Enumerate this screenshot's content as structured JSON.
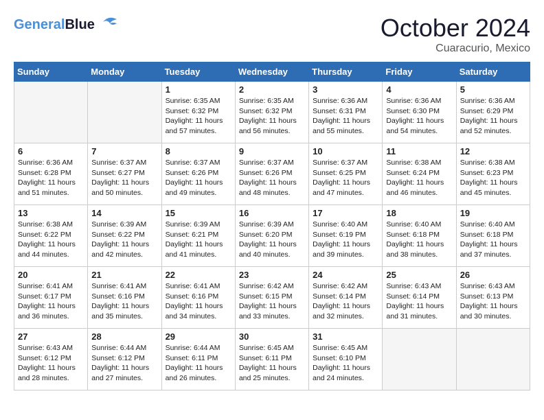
{
  "header": {
    "logo_line1": "General",
    "logo_line2": "Blue",
    "month": "October 2024",
    "location": "Cuaracurio, Mexico"
  },
  "days_of_week": [
    "Sunday",
    "Monday",
    "Tuesday",
    "Wednesday",
    "Thursday",
    "Friday",
    "Saturday"
  ],
  "weeks": [
    [
      {
        "day": "",
        "empty": true
      },
      {
        "day": "",
        "empty": true
      },
      {
        "day": "1",
        "lines": [
          "Sunrise: 6:35 AM",
          "Sunset: 6:32 PM",
          "Daylight: 11 hours",
          "and 57 minutes."
        ]
      },
      {
        "day": "2",
        "lines": [
          "Sunrise: 6:35 AM",
          "Sunset: 6:32 PM",
          "Daylight: 11 hours",
          "and 56 minutes."
        ]
      },
      {
        "day": "3",
        "lines": [
          "Sunrise: 6:36 AM",
          "Sunset: 6:31 PM",
          "Daylight: 11 hours",
          "and 55 minutes."
        ]
      },
      {
        "day": "4",
        "lines": [
          "Sunrise: 6:36 AM",
          "Sunset: 6:30 PM",
          "Daylight: 11 hours",
          "and 54 minutes."
        ]
      },
      {
        "day": "5",
        "lines": [
          "Sunrise: 6:36 AM",
          "Sunset: 6:29 PM",
          "Daylight: 11 hours",
          "and 52 minutes."
        ]
      }
    ],
    [
      {
        "day": "6",
        "lines": [
          "Sunrise: 6:36 AM",
          "Sunset: 6:28 PM",
          "Daylight: 11 hours",
          "and 51 minutes."
        ]
      },
      {
        "day": "7",
        "lines": [
          "Sunrise: 6:37 AM",
          "Sunset: 6:27 PM",
          "Daylight: 11 hours",
          "and 50 minutes."
        ]
      },
      {
        "day": "8",
        "lines": [
          "Sunrise: 6:37 AM",
          "Sunset: 6:26 PM",
          "Daylight: 11 hours",
          "and 49 minutes."
        ]
      },
      {
        "day": "9",
        "lines": [
          "Sunrise: 6:37 AM",
          "Sunset: 6:26 PM",
          "Daylight: 11 hours",
          "and 48 minutes."
        ]
      },
      {
        "day": "10",
        "lines": [
          "Sunrise: 6:37 AM",
          "Sunset: 6:25 PM",
          "Daylight: 11 hours",
          "and 47 minutes."
        ]
      },
      {
        "day": "11",
        "lines": [
          "Sunrise: 6:38 AM",
          "Sunset: 6:24 PM",
          "Daylight: 11 hours",
          "and 46 minutes."
        ]
      },
      {
        "day": "12",
        "lines": [
          "Sunrise: 6:38 AM",
          "Sunset: 6:23 PM",
          "Daylight: 11 hours",
          "and 45 minutes."
        ]
      }
    ],
    [
      {
        "day": "13",
        "lines": [
          "Sunrise: 6:38 AM",
          "Sunset: 6:22 PM",
          "Daylight: 11 hours",
          "and 44 minutes."
        ]
      },
      {
        "day": "14",
        "lines": [
          "Sunrise: 6:39 AM",
          "Sunset: 6:22 PM",
          "Daylight: 11 hours",
          "and 42 minutes."
        ]
      },
      {
        "day": "15",
        "lines": [
          "Sunrise: 6:39 AM",
          "Sunset: 6:21 PM",
          "Daylight: 11 hours",
          "and 41 minutes."
        ]
      },
      {
        "day": "16",
        "lines": [
          "Sunrise: 6:39 AM",
          "Sunset: 6:20 PM",
          "Daylight: 11 hours",
          "and 40 minutes."
        ]
      },
      {
        "day": "17",
        "lines": [
          "Sunrise: 6:40 AM",
          "Sunset: 6:19 PM",
          "Daylight: 11 hours",
          "and 39 minutes."
        ]
      },
      {
        "day": "18",
        "lines": [
          "Sunrise: 6:40 AM",
          "Sunset: 6:18 PM",
          "Daylight: 11 hours",
          "and 38 minutes."
        ]
      },
      {
        "day": "19",
        "lines": [
          "Sunrise: 6:40 AM",
          "Sunset: 6:18 PM",
          "Daylight: 11 hours",
          "and 37 minutes."
        ]
      }
    ],
    [
      {
        "day": "20",
        "lines": [
          "Sunrise: 6:41 AM",
          "Sunset: 6:17 PM",
          "Daylight: 11 hours",
          "and 36 minutes."
        ]
      },
      {
        "day": "21",
        "lines": [
          "Sunrise: 6:41 AM",
          "Sunset: 6:16 PM",
          "Daylight: 11 hours",
          "and 35 minutes."
        ]
      },
      {
        "day": "22",
        "lines": [
          "Sunrise: 6:41 AM",
          "Sunset: 6:16 PM",
          "Daylight: 11 hours",
          "and 34 minutes."
        ]
      },
      {
        "day": "23",
        "lines": [
          "Sunrise: 6:42 AM",
          "Sunset: 6:15 PM",
          "Daylight: 11 hours",
          "and 33 minutes."
        ]
      },
      {
        "day": "24",
        "lines": [
          "Sunrise: 6:42 AM",
          "Sunset: 6:14 PM",
          "Daylight: 11 hours",
          "and 32 minutes."
        ]
      },
      {
        "day": "25",
        "lines": [
          "Sunrise: 6:43 AM",
          "Sunset: 6:14 PM",
          "Daylight: 11 hours",
          "and 31 minutes."
        ]
      },
      {
        "day": "26",
        "lines": [
          "Sunrise: 6:43 AM",
          "Sunset: 6:13 PM",
          "Daylight: 11 hours",
          "and 30 minutes."
        ]
      }
    ],
    [
      {
        "day": "27",
        "lines": [
          "Sunrise: 6:43 AM",
          "Sunset: 6:12 PM",
          "Daylight: 11 hours",
          "and 28 minutes."
        ]
      },
      {
        "day": "28",
        "lines": [
          "Sunrise: 6:44 AM",
          "Sunset: 6:12 PM",
          "Daylight: 11 hours",
          "and 27 minutes."
        ]
      },
      {
        "day": "29",
        "lines": [
          "Sunrise: 6:44 AM",
          "Sunset: 6:11 PM",
          "Daylight: 11 hours",
          "and 26 minutes."
        ]
      },
      {
        "day": "30",
        "lines": [
          "Sunrise: 6:45 AM",
          "Sunset: 6:11 PM",
          "Daylight: 11 hours",
          "and 25 minutes."
        ]
      },
      {
        "day": "31",
        "lines": [
          "Sunrise: 6:45 AM",
          "Sunset: 6:10 PM",
          "Daylight: 11 hours",
          "and 24 minutes."
        ]
      },
      {
        "day": "",
        "empty": true
      },
      {
        "day": "",
        "empty": true
      }
    ]
  ]
}
